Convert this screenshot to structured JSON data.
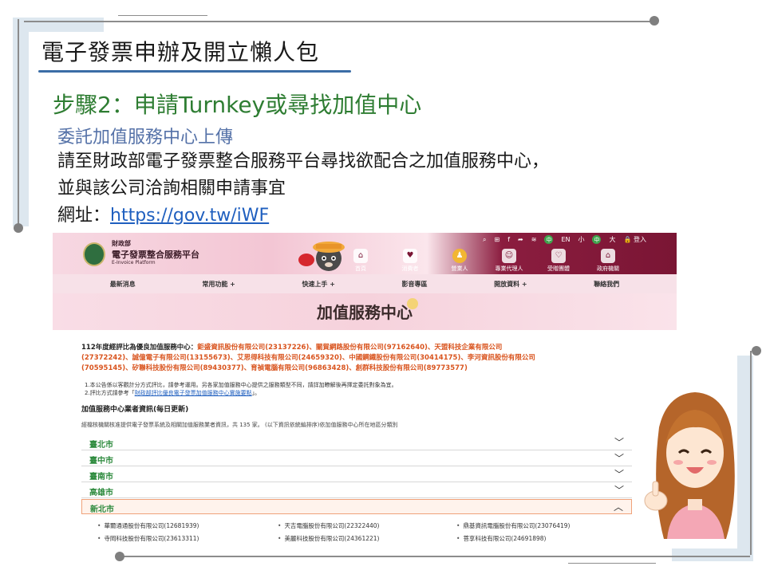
{
  "slide": {
    "title": "電子發票申辦及開立懶人包",
    "step_heading": "步驟2：申請Turnkey或尋找加值中心",
    "sub_heading": "委託加值服務中心上傳",
    "body_line1": "請至財政部電子發票整合服務平台尋找欲配合之加值服務中心，",
    "body_line2": "並與該公司洽詢相關申請事宜",
    "url_label": "網址：",
    "url": "https://gov.tw/iWF"
  },
  "site": {
    "ministry": "財政部",
    "platform_name": "電子發票整合服務平台",
    "platform_en": "E-Invoice Platform",
    "utility": [
      "EN",
      "小",
      "中",
      "大",
      "登入"
    ],
    "roles": [
      {
        "label": "首頁",
        "icon": "home-icon",
        "glyph": "⌂"
      },
      {
        "label": "消費者",
        "icon": "basket-icon",
        "glyph": "♥"
      },
      {
        "label": "營業人",
        "icon": "business-icon",
        "glyph": "♟"
      },
      {
        "label": "專業代理人",
        "icon": "agent-icon",
        "glyph": "☺"
      },
      {
        "label": "受贈團體",
        "icon": "donation-icon",
        "glyph": "♡"
      },
      {
        "label": "政府機關",
        "icon": "government-icon",
        "glyph": "⌂"
      }
    ],
    "menu": [
      "最新消息",
      "常用功能 +",
      "快速上手 +",
      "影音專區",
      "開放資料 +",
      "聯絡我們"
    ],
    "banner_title": "加值服務中心",
    "notice_prefix": "112年度經評比為優良加值服務中心：",
    "notice_companies_1": "鉅盛資訊股份有限公司(23137226)、關貿網路股份有限公司(97162640)、天盟科技企業有限公司",
    "notice_companies_2": "(27372242)、誠億電子有限公司(13155673)、艾思得科技有限公司(24659320)、中國鋼鐵股份有限公司(30414175)、李河資訊股份有限公司",
    "notice_companies_3": "(70595145)、矽聯科技股份有限公司(89430377)、育禎電腦有限公司(96863428)、創群科技股份有限公司(89773577)",
    "note1": "1.本公告係以客觀計分方式評比，請參考運用。另各家加值服務中心提供之服務類型不同，請詳加瞭解後再擇定委託對象為宜。",
    "note2_prefix": "2.評比方式請參考「",
    "note2_link": "財政部評比優良電子發票加值服務中心實施要點",
    "note2_suffix": "」。",
    "list_title": "加值服務中心業者資訊(每日更新)",
    "list_desc": "經檔核機關核准提供電子發票系統及相關加值服務業者資訊，共 135 家。 (以下資訊依統編排序)依加值服務中心所在地區分類別",
    "regions": [
      "臺北市",
      "臺中市",
      "臺南市",
      "高雄市",
      "新北市"
    ],
    "vendors": [
      "華爾通通股份有限公司(12681939)",
      "天吉電腦股份有限公司(22322440)",
      "鼎基資訊電腦股份有限公司(23076419)",
      "寺岡科技股份有限公司(23613311)",
      "美麗科技股份有限公司(24361221)",
      "菩享科技有限公司(24691898)"
    ]
  },
  "colors": {
    "title_underline": "#3b6da6",
    "step_green": "#2e7d32",
    "sub_blue": "#5572a8",
    "link_blue": "#1f5fbf",
    "site_maroon": "#7a1534",
    "notice_orange": "#d9541e",
    "region_green": "#2e8b3e"
  }
}
